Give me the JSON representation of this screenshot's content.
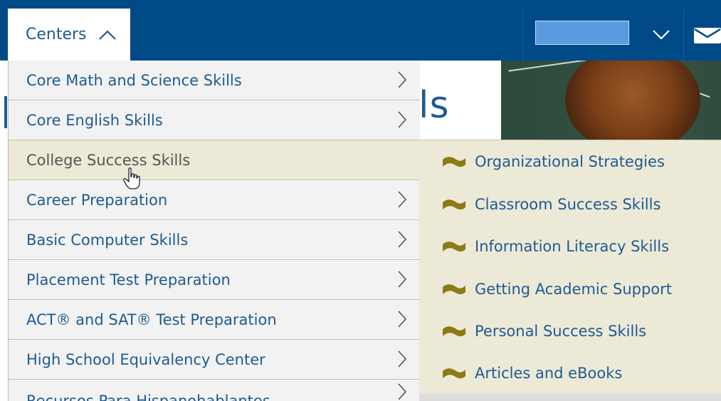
{
  "header": {
    "centers_label": "Centers",
    "search_value": ""
  },
  "hero": {
    "title_partial": "ls"
  },
  "menu": {
    "items": [
      {
        "label": "Core Math and Science Skills"
      },
      {
        "label": "Core English Skills"
      },
      {
        "label": "College Success Skills"
      },
      {
        "label": "Career Preparation"
      },
      {
        "label": "Basic Computer Skills"
      },
      {
        "label": "Placement Test Preparation"
      },
      {
        "label": "ACT® and SAT® Test Preparation"
      },
      {
        "label": "High School Equivalency Center"
      },
      {
        "label": "Recursos Para Hispanohablantes"
      }
    ]
  },
  "submenu": {
    "items": [
      {
        "label": "Organizational Strategies"
      },
      {
        "label": "Classroom Success Skills"
      },
      {
        "label": "Information Literacy Skills"
      },
      {
        "label": "Getting Academic Support"
      },
      {
        "label": "Personal Success Skills"
      },
      {
        "label": "Articles and eBooks"
      }
    ]
  },
  "colors": {
    "navbar": "#004a87",
    "link": "#1f5b92",
    "menu_bg": "#f2f2f2",
    "active_bg": "#ece9d6",
    "flag": "#8c7a14"
  },
  "icons": {
    "centers_toggle": "chevron-up-icon",
    "dropdown": "chevron-down-icon",
    "mail": "mail-icon",
    "submenu_arrow": "chevron-right-icon",
    "bullet": "flag-icon",
    "pointer": "hand-cursor-icon"
  }
}
